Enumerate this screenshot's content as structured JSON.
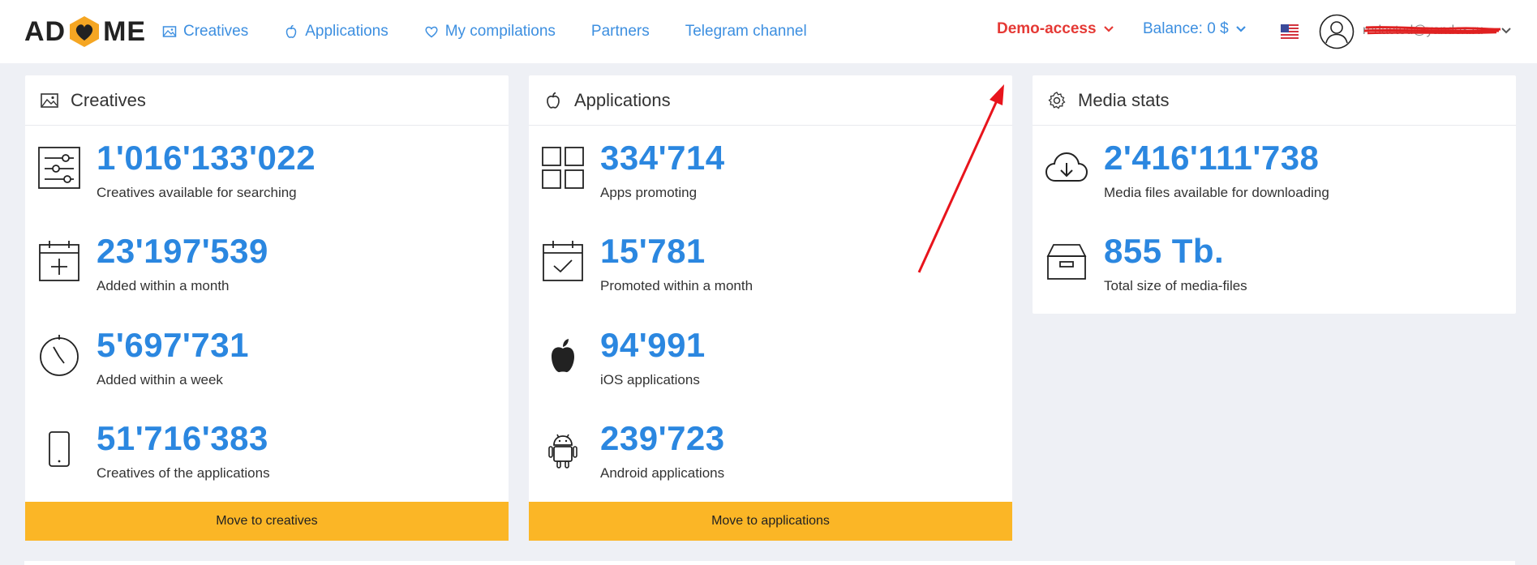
{
  "header": {
    "logo": {
      "left": "AD",
      "right": "ME"
    },
    "nav": [
      {
        "label": "Creatives",
        "icon": "image-icon"
      },
      {
        "label": "Applications",
        "icon": "apple-icon"
      },
      {
        "label": "My compilations",
        "icon": "heart-icon"
      },
      {
        "label": "Partners",
        "icon": ""
      },
      {
        "label": "Telegram channel",
        "icon": ""
      }
    ],
    "demo_access": "Demo-access",
    "balance": "Balance: 0 $",
    "flag": "us-flag-icon",
    "user_name": "redacted@yandex.ru"
  },
  "cards": {
    "creatives": {
      "title": "Creatives",
      "stats": [
        {
          "value": "1'016'133'022",
          "label": "Creatives available for searching",
          "icon": "filter-sliders-icon"
        },
        {
          "value": "23'197'539",
          "label": "Added within a month",
          "icon": "calendar-plus-icon"
        },
        {
          "value": "5'697'731",
          "label": "Added within a week",
          "icon": "stopwatch-icon"
        },
        {
          "value": "51'716'383",
          "label": "Creatives of the applications",
          "icon": "smartphone-icon"
        }
      ],
      "button": "Move to creatives"
    },
    "applications": {
      "title": "Applications",
      "stats": [
        {
          "value": "334'714",
          "label": "Apps promoting",
          "icon": "grid-icon"
        },
        {
          "value": "15'781",
          "label": "Promoted within a month",
          "icon": "calendar-check-icon"
        },
        {
          "value": "94'991",
          "label": "iOS applications",
          "icon": "apple-icon"
        },
        {
          "value": "239'723",
          "label": "Android applications",
          "icon": "android-icon"
        }
      ],
      "button": "Move to applications"
    },
    "media": {
      "title": "Media stats",
      "stats": [
        {
          "value": "2'416'111'738",
          "label": "Media files available for downloading",
          "icon": "cloud-download-icon"
        },
        {
          "value": "855 Tb.",
          "label": "Total size of media-files",
          "icon": "archive-box-icon"
        }
      ]
    }
  },
  "colors": {
    "accent": "#2b87e0",
    "link": "#3d8fe0",
    "button": "#fbb626",
    "demo": "#e53935",
    "background": "#eef0f5"
  }
}
